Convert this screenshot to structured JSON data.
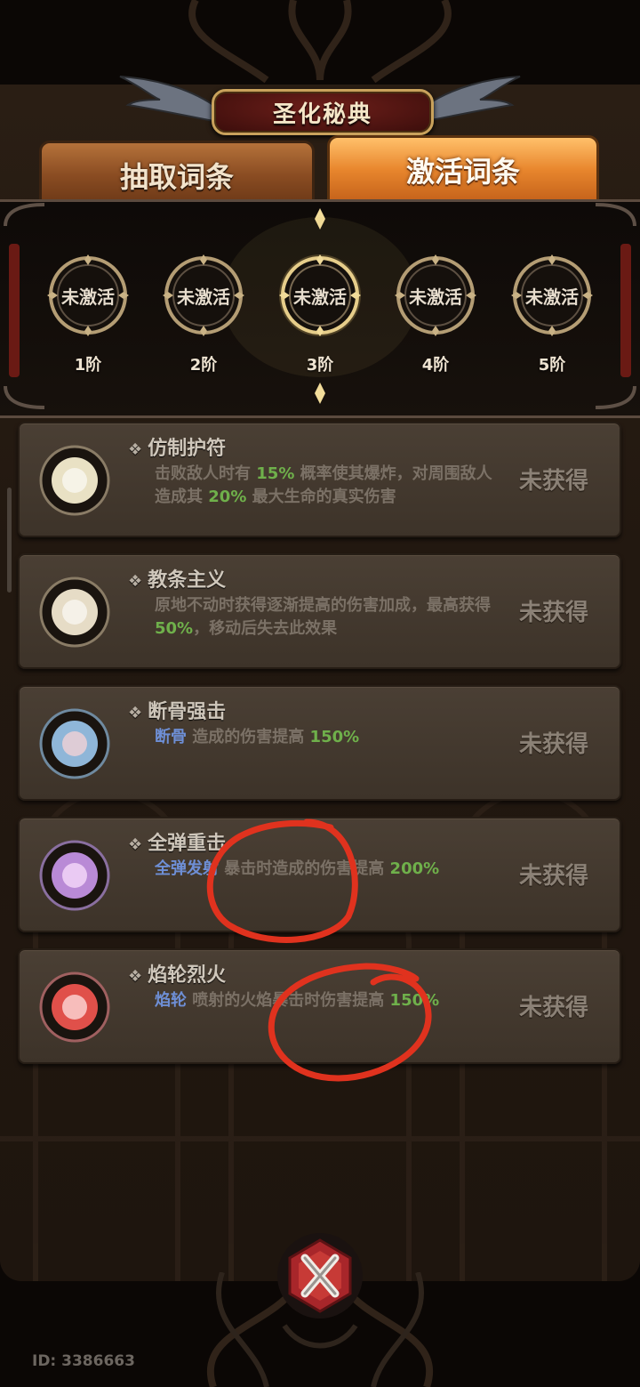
{
  "title": "圣化秘典",
  "tabs": [
    {
      "label": "抽取词条",
      "active": false
    },
    {
      "label": "激活词条",
      "active": true
    }
  ],
  "tiers": [
    {
      "status": "未激活",
      "label": "1阶"
    },
    {
      "status": "未激活",
      "label": "2阶"
    },
    {
      "status": "未激活",
      "label": "3阶"
    },
    {
      "status": "未激活",
      "label": "4阶"
    },
    {
      "status": "未激活",
      "label": "5阶"
    }
  ],
  "entries": [
    {
      "name": "仿制护符",
      "desc": [
        {
          "t": "击败敌人时有 "
        },
        {
          "t": "15%",
          "c": "g"
        },
        {
          "t": " 概率使其爆炸，对周围敌人造成其 "
        },
        {
          "t": "20%",
          "c": "g"
        },
        {
          "t": " 最大生命的真实伤害"
        }
      ],
      "status": "未获得"
    },
    {
      "name": "教条主义",
      "desc": [
        {
          "t": "原地不动时获得逐渐提高的伤害加成，最高获得 "
        },
        {
          "t": "50%",
          "c": "g"
        },
        {
          "t": "，移动后失去此效果"
        }
      ],
      "status": "未获得"
    },
    {
      "name": "断骨强击",
      "desc": [
        {
          "t": "断骨",
          "c": "b"
        },
        {
          "t": " 造成的伤害提高 "
        },
        {
          "t": "150%",
          "c": "g"
        }
      ],
      "status": "未获得"
    },
    {
      "name": "全弹重击",
      "desc": [
        {
          "t": "全弹发射",
          "c": "b"
        },
        {
          "t": " 暴击时造成的伤害提高 "
        },
        {
          "t": "200%",
          "c": "g"
        }
      ],
      "status": "未获得"
    },
    {
      "name": "焰轮烈火",
      "desc": [
        {
          "t": "焰轮",
          "c": "b"
        },
        {
          "t": " 喷射的火焰暴击时伤害提高 "
        },
        {
          "t": "150%",
          "c": "g"
        }
      ],
      "status": "未获得"
    }
  ],
  "user_id": "ID: 3386663",
  "colors": {
    "highlight_green": "#6fb04b",
    "highlight_blue": "#6e8fd6",
    "tab_active": "#e8862d",
    "annotation_red": "#e0321e"
  },
  "orb_colors": [
    "#e9e1c4",
    "#e6dcc6",
    "#8fb6d8",
    "#b98ad6",
    "#e0504a"
  ]
}
